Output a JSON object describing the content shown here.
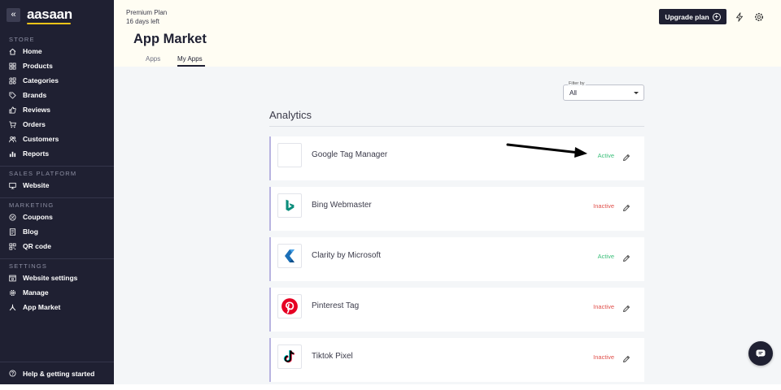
{
  "sidebar": {
    "logo": "aasaan",
    "collapse_icon": "«",
    "sections": [
      {
        "label": "STORE",
        "items": [
          {
            "label": "Home",
            "icon": "home-icon"
          },
          {
            "label": "Products",
            "icon": "products-icon"
          },
          {
            "label": "Categories",
            "icon": "categories-icon"
          },
          {
            "label": "Brands",
            "icon": "tag-icon"
          },
          {
            "label": "Reviews",
            "icon": "thumbs-up-icon"
          },
          {
            "label": "Orders",
            "icon": "cart-icon"
          },
          {
            "label": "Customers",
            "icon": "users-icon"
          },
          {
            "label": "Reports",
            "icon": "chart-icon"
          }
        ]
      },
      {
        "label": "SALES PLATFORM",
        "items": [
          {
            "label": "Website",
            "icon": "monitor-icon"
          }
        ]
      },
      {
        "label": "MARKETING",
        "items": [
          {
            "label": "Coupons",
            "icon": "coupon-icon"
          },
          {
            "label": "Blog",
            "icon": "blog-icon"
          },
          {
            "label": "QR code",
            "icon": "qr-icon"
          }
        ]
      },
      {
        "label": "SETTINGS",
        "items": [
          {
            "label": "Website settings",
            "icon": "website-settings-icon"
          },
          {
            "label": "Manage",
            "icon": "gear-icon"
          },
          {
            "label": "App Market",
            "icon": "app-market-icon"
          }
        ]
      }
    ],
    "help_label": "Help & getting started"
  },
  "header": {
    "plan_name": "Premium Plan",
    "plan_days": "16 days left",
    "title": "App Market",
    "tabs": [
      {
        "label": "Apps",
        "active": false
      },
      {
        "label": "My Apps",
        "active": true
      }
    ],
    "upgrade_label": "Upgrade plan"
  },
  "filter": {
    "label": "Filter by",
    "value": "All"
  },
  "section_title": "Analytics",
  "apps": [
    {
      "name": "Google Tag Manager",
      "status": "Active",
      "icon": "google-tag-manager-logo"
    },
    {
      "name": "Bing Webmaster",
      "status": "Inactive",
      "icon": "bing-logo"
    },
    {
      "name": "Clarity by Microsoft",
      "status": "Active",
      "icon": "clarity-logo"
    },
    {
      "name": "Pinterest Tag",
      "status": "Inactive",
      "icon": "pinterest-logo"
    },
    {
      "name": "Tiktok Pixel",
      "status": "Inactive",
      "icon": "tiktok-logo"
    }
  ],
  "colors": {
    "sidebar_bg": "#1f2032",
    "active": "#3bbf7a",
    "inactive": "#e0504b",
    "accent": "#b8b4e0",
    "logo_underline": "#f5c518"
  }
}
